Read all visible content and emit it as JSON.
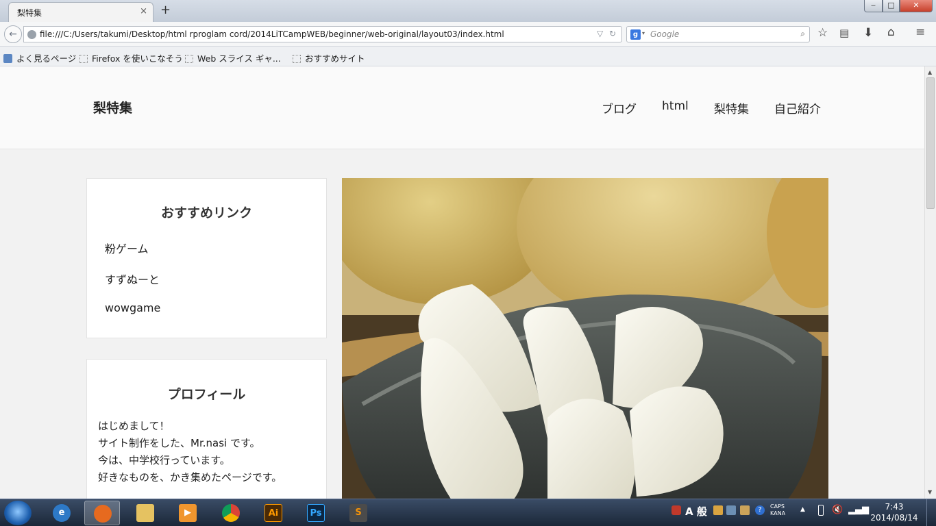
{
  "browser": {
    "tab_title": "梨特集",
    "tab_close": "×",
    "new_tab": "+",
    "window_controls": {
      "minimize": "‒",
      "maximize": "□",
      "close": "✕"
    },
    "url": "file:///C:/Users/takumi/Desktop/html rproglam cord/2014LiTCampWEB/beginner/web-original/layout03/index.html",
    "search_placeholder": "Google",
    "search_engine_badge": "g",
    "icons": [
      "back-icon",
      "globe-icon",
      "dropdown-icon",
      "reload-icon",
      "search-icon",
      "bookmark-star-icon",
      "reading-list-icon",
      "download-icon",
      "home-icon",
      "menu-icon"
    ]
  },
  "bookmarks": [
    {
      "label": "よく見るページ",
      "icon": "bookmark-icon"
    },
    {
      "label": "Firefox を使いこなそう",
      "icon": "page-icon"
    },
    {
      "label": "Web スライス ギャ...",
      "icon": "page-icon"
    },
    {
      "label": "おすすめサイト",
      "icon": "page-icon"
    }
  ],
  "site": {
    "title": "梨特集",
    "nav": [
      "ブログ",
      "html",
      "梨特集",
      "自己紹介"
    ],
    "links_widget": {
      "title": "おすすめリンク",
      "items": [
        "粉ゲーム",
        "すずぬーと",
        "wowgame"
      ]
    },
    "profile_widget": {
      "title": "プロフィール",
      "lines": [
        "はじめまして！",
        "サイト制作をした、Mr.nasi です。",
        "今は、中学校行っています。",
        "好きなものを、かき集めたページです。"
      ]
    },
    "hero_image": "sliced-pear-photo"
  },
  "taskbar": {
    "apps": [
      "start-orb",
      "internet-explorer",
      "firefox",
      "file-explorer",
      "media-player",
      "chrome",
      "illustrator",
      "photoshop",
      "sublime-text"
    ],
    "app_glyphs": {
      "illustrator": "Ai",
      "photoshop": "Ps",
      "sublime": "S",
      "ime": "A 般"
    },
    "tray_caps": "CAPS",
    "tray_kana": "KANA",
    "time": "7:43",
    "date": "2014/08/14"
  },
  "colors": {
    "page_background": "#f2f2f2",
    "header_background": "#fafafa",
    "widget_background": "#ffffff",
    "taskbar": "#1b2738"
  }
}
